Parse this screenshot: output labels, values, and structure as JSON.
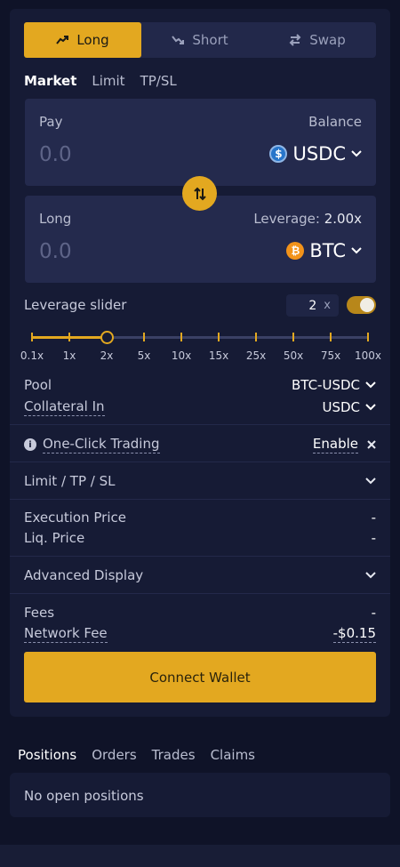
{
  "trade_tabs": [
    {
      "label": "Long",
      "icon": "trend-up-icon"
    },
    {
      "label": "Short",
      "icon": "trend-down-icon"
    },
    {
      "label": "Swap",
      "icon": "swap-arrows-icon"
    }
  ],
  "order_types": [
    "Market",
    "Limit",
    "TP/SL"
  ],
  "pay": {
    "label": "Pay",
    "balance_label": "Balance",
    "amount": "0.0",
    "token": "USDC"
  },
  "long": {
    "label": "Long",
    "leverage_label": "Leverage:",
    "leverage_value": "2.00x",
    "amount": "0.0",
    "token": "BTC"
  },
  "leverage_slider": {
    "label": "Leverage slider",
    "value": "2",
    "unit": "x",
    "enabled": true,
    "ticks": [
      "0.1x",
      "1x",
      "2x",
      "5x",
      "10x",
      "15x",
      "25x",
      "50x",
      "75x",
      "100x"
    ],
    "selected_index": 2
  },
  "pool": {
    "label": "Pool",
    "value": "BTC-USDC"
  },
  "collateral": {
    "label": "Collateral In",
    "value": "USDC"
  },
  "one_click": {
    "label": "One-Click Trading",
    "action": "Enable"
  },
  "limit_section": {
    "label": "Limit / TP / SL"
  },
  "execution_price": {
    "label": "Execution Price",
    "value": "-"
  },
  "liq_price": {
    "label": "Liq. Price",
    "value": "-"
  },
  "advanced": {
    "label": "Advanced Display"
  },
  "fees": {
    "label": "Fees",
    "value": "-"
  },
  "network_fee": {
    "label": "Network Fee",
    "value": "-$0.15"
  },
  "connect_label": "Connect Wallet",
  "position_tabs": [
    "Positions",
    "Orders",
    "Trades",
    "Claims"
  ],
  "no_positions": "No open positions",
  "colors": {
    "accent": "#e3a820",
    "background": "#0f1328",
    "panel": "#161b35"
  }
}
